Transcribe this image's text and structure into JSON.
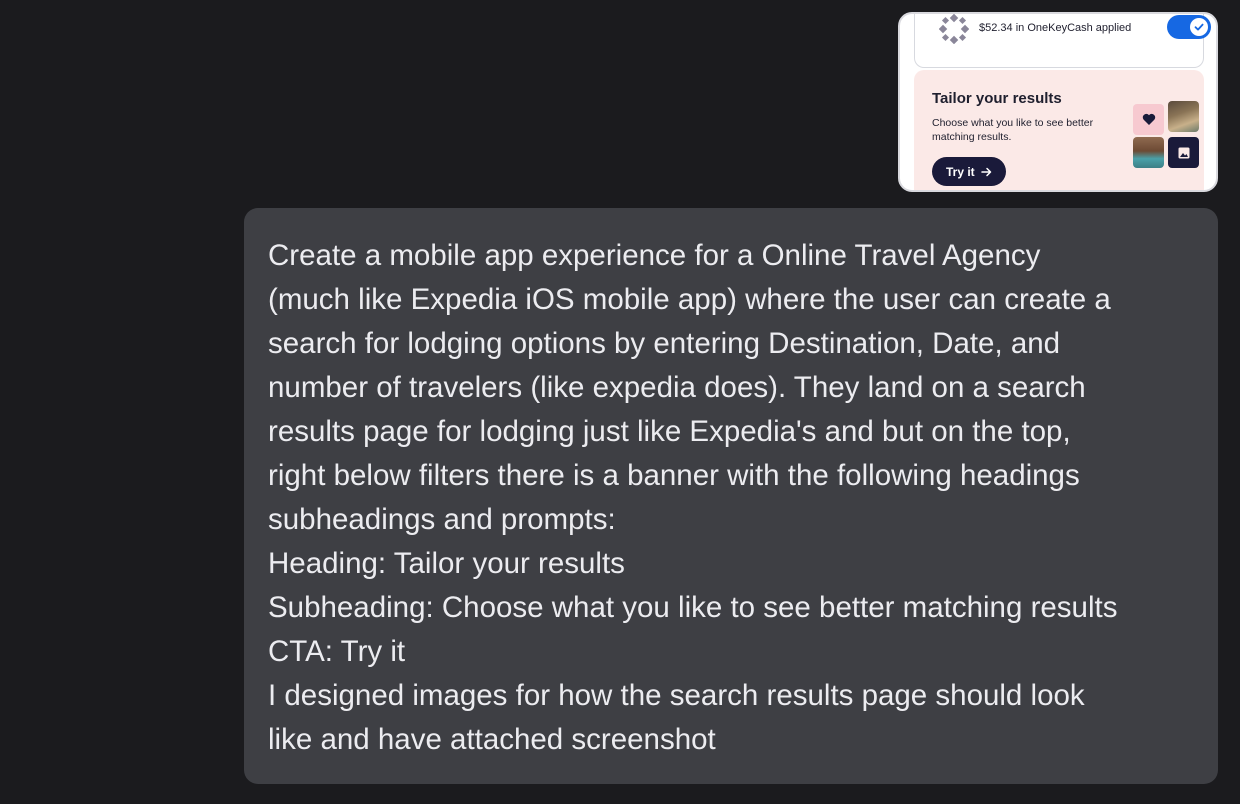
{
  "attachment": {
    "onekeycash_text": "$52.34 in OneKeyCash applied",
    "banner": {
      "heading": "Tailor your results",
      "subheading": "Choose what you like to see better matching results.",
      "cta_label": "Try it"
    },
    "icons": [
      "onekeycash-icon",
      "check-icon",
      "heart-icon",
      "image-icon",
      "arrow-right-icon"
    ],
    "colors": {
      "toggle": "#1668e3",
      "banner_bg": "#fbe9e7",
      "cta_bg": "#1a1a3a",
      "heart_tile": "#f7c9d0"
    }
  },
  "message": {
    "lines": [
      "Create a mobile app experience for a Online Travel Agency",
      "(much like Expedia iOS mobile app) where the user can create a",
      "search for lodging options by entering Destination, Date, and",
      "number of travelers (like expedia does). They land on a search",
      "results page for lodging just like Expedia's and but on the top,",
      "right below filters there is a banner with the following headings",
      "subheadings and prompts:",
      "Heading: Tailor your results",
      "Subheading: Choose what you like to see better matching results",
      "CTA: Try it",
      "I designed images for how the search results page should look",
      "like and have attached screenshot"
    ]
  },
  "colors": {
    "page_bg": "#1b1b1e",
    "bubble_bg": "#3e3f44",
    "text": "#ececf0"
  }
}
